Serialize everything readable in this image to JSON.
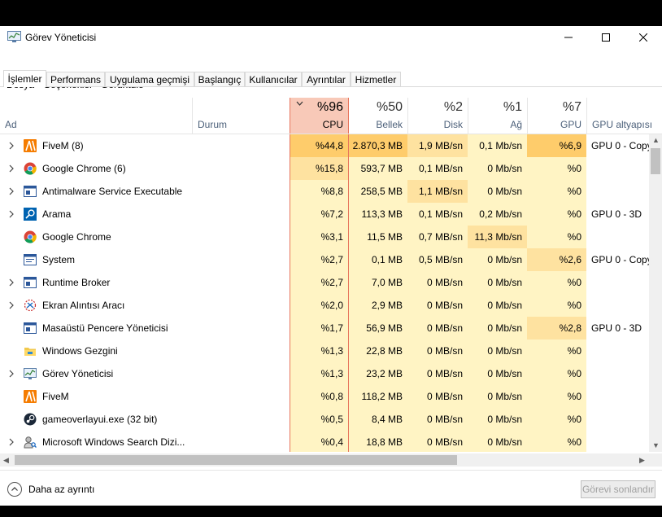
{
  "window": {
    "title": "Görev Yöneticisi"
  },
  "menu": [
    {
      "label": "Dosya"
    },
    {
      "label": "Seçenekler"
    },
    {
      "label": "Görüntüle"
    }
  ],
  "tabs": [
    {
      "label": "İşlemler",
      "active": true
    },
    {
      "label": "Performans"
    },
    {
      "label": "Uygulama geçmişi"
    },
    {
      "label": "Başlangıç"
    },
    {
      "label": "Kullanıcılar"
    },
    {
      "label": "Ayrıntılar"
    },
    {
      "label": "Hizmetler"
    }
  ],
  "columns": {
    "name": {
      "label": "Ad"
    },
    "status": {
      "label": "Durum"
    },
    "cpu": {
      "pct": "%96",
      "label": "CPU",
      "sorted": "descending"
    },
    "memory": {
      "pct": "%50",
      "label": "Bellek"
    },
    "disk": {
      "pct": "%2",
      "label": "Disk"
    },
    "network": {
      "pct": "%1",
      "label": "Ağ"
    },
    "gpu": {
      "pct": "%7",
      "label": "GPU"
    },
    "gpu_engine": {
      "label": "GPU altyapısı"
    }
  },
  "processes": [
    {
      "name": "FiveM (8)",
      "icon": "fivem-icon",
      "expandable": true,
      "cpu": "%44,8",
      "memory": "2.870,3 MB",
      "disk": "1,9 MB/sn",
      "network": "0,1 Mb/sn",
      "gpu": "%6,9",
      "gpu_engine": "GPU 0 - Copy"
    },
    {
      "name": "Google Chrome (6)",
      "icon": "chrome-icon",
      "expandable": true,
      "cpu": "%15,8",
      "memory": "593,7 MB",
      "disk": "0,1 MB/sn",
      "network": "0 Mb/sn",
      "gpu": "%0",
      "gpu_engine": ""
    },
    {
      "name": "Antimalware Service Executable",
      "icon": "service-window-icon",
      "expandable": true,
      "cpu": "%8,8",
      "memory": "258,5 MB",
      "disk": "1,1 MB/sn",
      "network": "0 Mb/sn",
      "gpu": "%0",
      "gpu_engine": ""
    },
    {
      "name": "Arama",
      "icon": "search-icon",
      "expandable": true,
      "cpu": "%7,2",
      "memory": "113,3 MB",
      "disk": "0,1 MB/sn",
      "network": "0,2 Mb/sn",
      "gpu": "%0",
      "gpu_engine": "GPU 0 - 3D"
    },
    {
      "name": "Google Chrome",
      "icon": "chrome-icon",
      "expandable": false,
      "cpu": "%3,1",
      "memory": "11,5 MB",
      "disk": "0,7 MB/sn",
      "network": "11,3 Mb/sn",
      "gpu": "%0",
      "gpu_engine": ""
    },
    {
      "name": "System",
      "icon": "system-window-icon",
      "expandable": false,
      "cpu": "%2,7",
      "memory": "0,1 MB",
      "disk": "0,5 MB/sn",
      "network": "0 Mb/sn",
      "gpu": "%2,6",
      "gpu_engine": "GPU 0 - Copy"
    },
    {
      "name": "Runtime Broker",
      "icon": "service-window-icon",
      "expandable": true,
      "cpu": "%2,7",
      "memory": "7,0 MB",
      "disk": "0 MB/sn",
      "network": "0 Mb/sn",
      "gpu": "%0",
      "gpu_engine": ""
    },
    {
      "name": "Ekran Alıntısı Aracı",
      "icon": "snipping-tool-icon",
      "expandable": true,
      "cpu": "%2,0",
      "memory": "2,9 MB",
      "disk": "0 MB/sn",
      "network": "0 Mb/sn",
      "gpu": "%0",
      "gpu_engine": ""
    },
    {
      "name": "Masaüstü Pencere Yöneticisi",
      "icon": "service-window-icon",
      "expandable": false,
      "cpu": "%1,7",
      "memory": "56,9 MB",
      "disk": "0 MB/sn",
      "network": "0 Mb/sn",
      "gpu": "%2,8",
      "gpu_engine": "GPU 0 - 3D"
    },
    {
      "name": "Windows Gezgini",
      "icon": "folder-icon",
      "expandable": false,
      "cpu": "%1,3",
      "memory": "22,8 MB",
      "disk": "0 MB/sn",
      "network": "0 Mb/sn",
      "gpu": "%0",
      "gpu_engine": ""
    },
    {
      "name": "Görev Yöneticisi",
      "icon": "task-manager-icon",
      "expandable": true,
      "cpu": "%1,3",
      "memory": "23,2 MB",
      "disk": "0 MB/sn",
      "network": "0 Mb/sn",
      "gpu": "%0",
      "gpu_engine": ""
    },
    {
      "name": "FiveM",
      "icon": "fivem-icon",
      "expandable": false,
      "cpu": "%0,8",
      "memory": "118,2 MB",
      "disk": "0 MB/sn",
      "network": "0 Mb/sn",
      "gpu": "%0",
      "gpu_engine": ""
    },
    {
      "name": "gameoverlayui.exe (32 bit)",
      "icon": "steam-icon",
      "expandable": false,
      "cpu": "%0,5",
      "memory": "8,4 MB",
      "disk": "0 MB/sn",
      "network": "0 Mb/sn",
      "gpu": "%0",
      "gpu_engine": ""
    },
    {
      "name": "Microsoft Windows Search Dizi...",
      "icon": "search-indexer-icon",
      "expandable": true,
      "cpu": "%0,4",
      "memory": "18,8 MB",
      "disk": "0 MB/sn",
      "network": "0 Mb/sn",
      "gpu": "%0",
      "gpu_engine": ""
    }
  ],
  "footer": {
    "less_details": "Daha az ayrıntı",
    "end_task": "Görevi sonlandır"
  },
  "colors": {
    "cpu_header": "#f8c9b8",
    "cpu_border": "#e8765d",
    "heat_high": "#fecc6b",
    "heat_mid": "#fee2a0",
    "heat_low": "#fff4c4"
  }
}
